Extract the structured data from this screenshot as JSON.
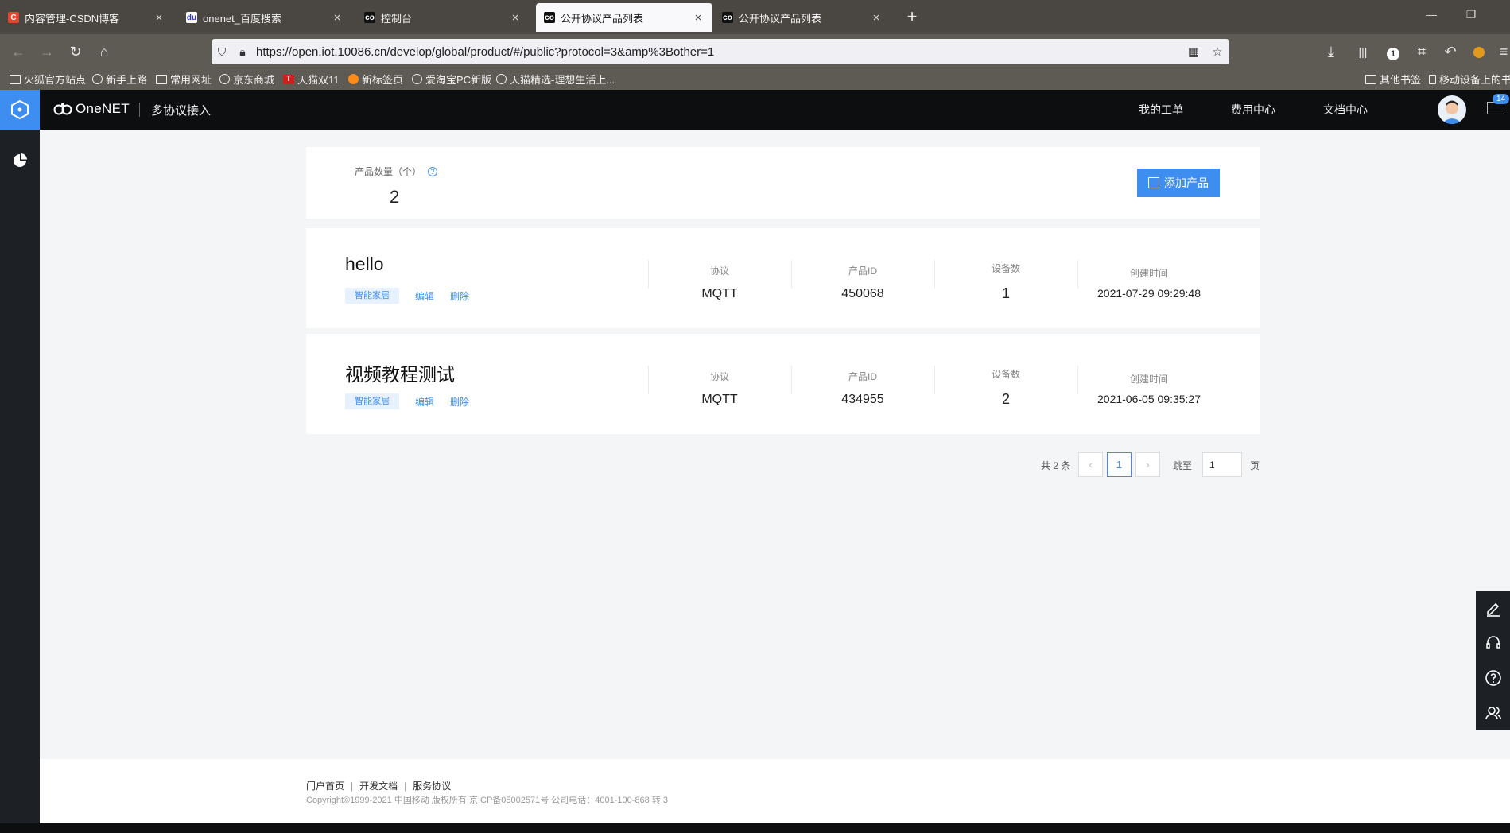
{
  "browser": {
    "tabs": [
      {
        "label": "内容管理-CSDN博客",
        "icon": "csdn-icon"
      },
      {
        "label": "onenet_百度搜索",
        "icon": "baidu-icon"
      },
      {
        "label": "控制台",
        "icon": "onenet-icon"
      },
      {
        "label": "公开协议产品列表",
        "icon": "onenet-icon",
        "active": true
      },
      {
        "label": "公开协议产品列表",
        "icon": "onenet-icon"
      }
    ],
    "url": "https://open.iot.10086.cn/develop/global/product/#/public?protocol=3&amp%3Bother=1",
    "toolbar_badge": "1",
    "bookmarks": [
      {
        "label": "火狐官方站点",
        "icon": "folder-icon"
      },
      {
        "label": "新手上路",
        "icon": "globe-icon"
      },
      {
        "label": "常用网址",
        "icon": "folder-icon"
      },
      {
        "label": "京东商城",
        "icon": "globe-icon"
      },
      {
        "label": "天猫双11",
        "icon": "tmall-icon"
      },
      {
        "label": "新标签页",
        "icon": "firefox-icon"
      },
      {
        "label": "爱淘宝PC新版",
        "icon": "globe-icon"
      },
      {
        "label": "天猫精选-理想生活上...",
        "icon": "globe-icon"
      }
    ],
    "bookmarks_right": [
      {
        "label": "其他书签",
        "icon": "folder-icon"
      },
      {
        "label": "移动设备上的书签",
        "icon": "mobile-icon"
      }
    ]
  },
  "header": {
    "brand": "OneNET",
    "subtitle": "多协议接入",
    "nav": [
      "我的工单",
      "费用中心",
      "文档中心"
    ],
    "mail_count": "14"
  },
  "summary": {
    "label": "产品数量（个）",
    "help": "?",
    "count": "2",
    "add_button": "添加产品"
  },
  "columns": {
    "protocol": "协议",
    "product_id": "产品ID",
    "device_count": "设备数",
    "created": "创建时间"
  },
  "products": [
    {
      "name": "hello",
      "tag": "智能家居",
      "edit": "编辑",
      "delete": "删除",
      "protocol": "MQTT",
      "id": "450068",
      "devices": "1",
      "created": "2021-07-29 09:29:48"
    },
    {
      "name": "视频教程测试",
      "tag": "智能家居",
      "edit": "编辑",
      "delete": "删除",
      "protocol": "MQTT",
      "id": "434955",
      "devices": "2",
      "created": "2021-06-05 09:35:27"
    }
  ],
  "pagination": {
    "total": "共 2 条",
    "current_page": "1",
    "jump_label": "跳至",
    "jump_value": "1",
    "page_suffix": "页"
  },
  "footer": {
    "links": [
      "门户首页",
      "开发文档",
      "服务协议"
    ],
    "separator": "|",
    "copyright": "Copyright©1999-2021 中国移动 版权所有 京ICP备05002571号 公司电话：4001-100-868 转 3"
  },
  "colors": {
    "accent": "#3d8ef0",
    "header_bg": "#0d0e10",
    "sidebar_bg": "#1d2025",
    "page_bg": "#f4f5f7"
  }
}
